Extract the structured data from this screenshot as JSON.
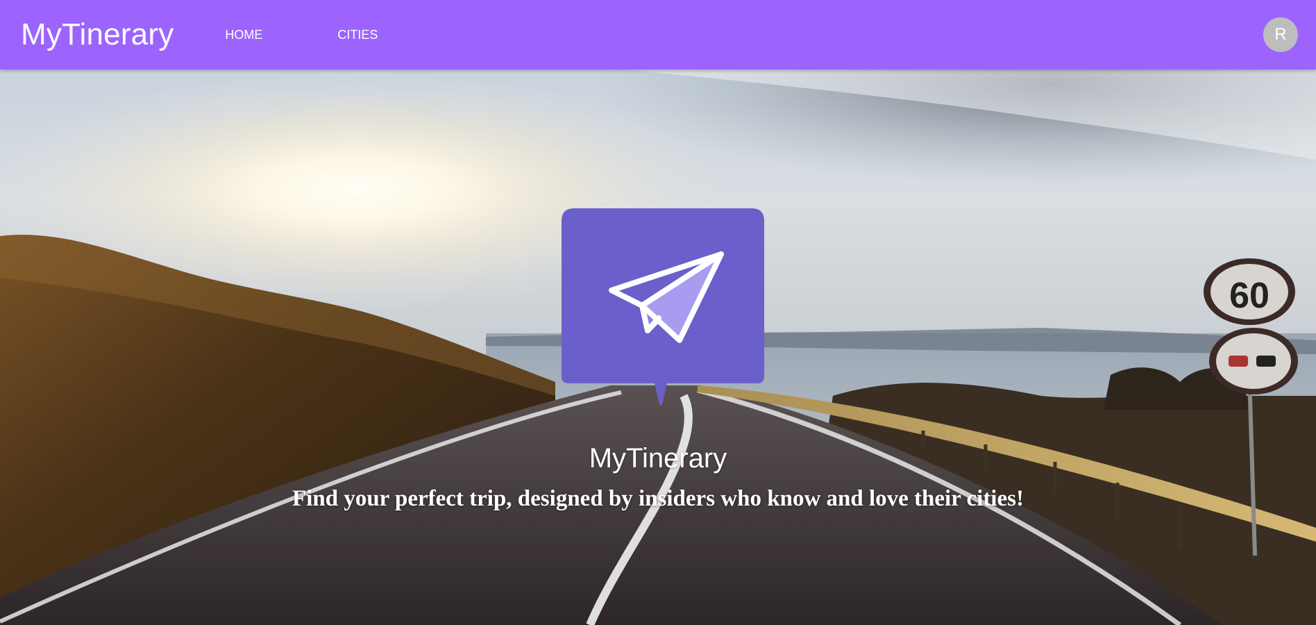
{
  "appbar": {
    "brand": "MyTinerary",
    "nav": [
      {
        "label": "HOME"
      },
      {
        "label": "CITIES"
      }
    ],
    "avatar_initial": "R",
    "color": "#9c64fc"
  },
  "hero": {
    "title": "MyTinerary",
    "tagline": "Find your perfect trip, designed by insiders who know and love their cities!",
    "logo_icon": "paper-plane-icon",
    "logo_color": "#6b5fcc",
    "road_sign": "60"
  }
}
